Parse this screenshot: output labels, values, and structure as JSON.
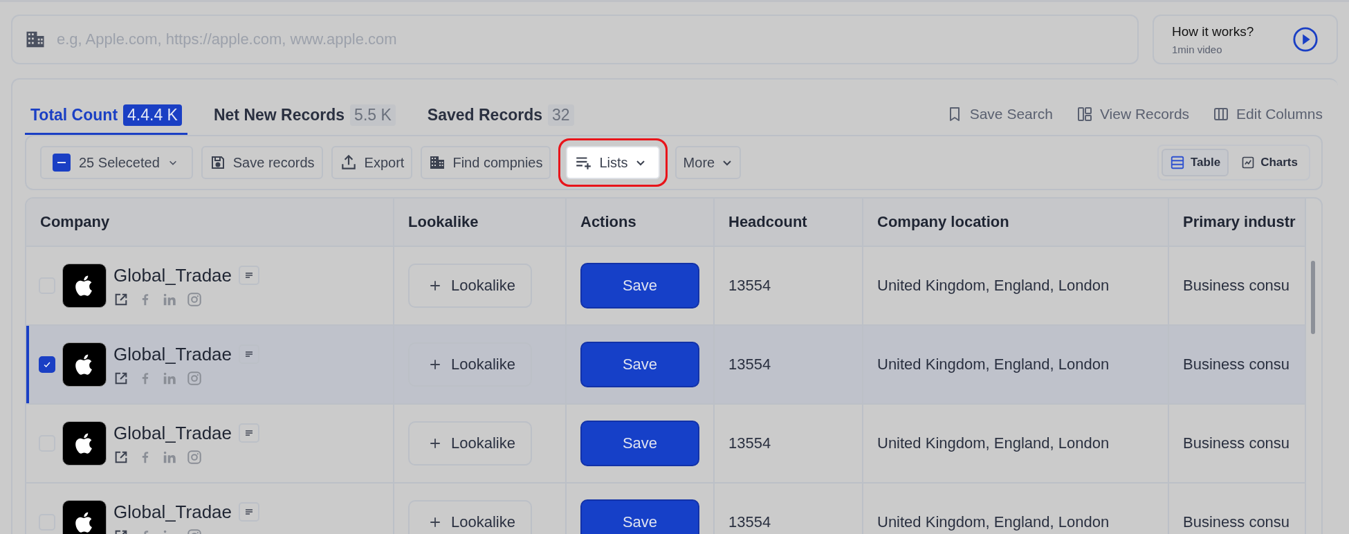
{
  "search": {
    "placeholder": "e.g, Apple.com, https://apple.com, www.apple.com"
  },
  "help_card": {
    "title": "How it works?",
    "subtitle": "1min video"
  },
  "tabs": [
    {
      "label": "Total Count",
      "count": "4.4.4 K",
      "selected": true
    },
    {
      "label": "Net New Records",
      "count": "5.5 K",
      "selected": false
    },
    {
      "label": "Saved Records",
      "count": "32",
      "selected": false
    }
  ],
  "header_actions": [
    "Save Search",
    "View Records",
    "Edit Columns"
  ],
  "toolbar": {
    "selection": {
      "label": "25 Seleceted"
    },
    "buttons": [
      {
        "label": "Save records",
        "highlighted": false
      },
      {
        "label": "Export",
        "highlighted": false
      },
      {
        "label": "Find compnies",
        "highlighted": false
      },
      {
        "label": "Lists",
        "highlighted": true
      },
      {
        "label": "More",
        "highlighted": false
      }
    ],
    "views": [
      {
        "label": "Table",
        "selected": true
      },
      {
        "label": "Charts",
        "selected": false
      }
    ]
  },
  "table": {
    "columns": [
      "Company",
      "Lookalike",
      "Actions",
      "Headcount",
      "Company location",
      "Primary industr"
    ],
    "rows": [
      {
        "selected": false,
        "name": "Global_Tradae",
        "lookalike": "Lookalike",
        "action": "Save",
        "headcount": "13554",
        "location": "United Kingdom, England, London",
        "industry": "Business consu"
      },
      {
        "selected": true,
        "name": "Global_Tradae",
        "lookalike": "Lookalike",
        "action": "Save",
        "headcount": "13554",
        "location": "United Kingdom, England, London",
        "industry": "Business consu"
      },
      {
        "selected": false,
        "name": "Global_Tradae",
        "lookalike": "Lookalike",
        "action": "Save",
        "headcount": "13554",
        "location": "United Kingdom, England, London",
        "industry": "Business consu"
      },
      {
        "selected": false,
        "name": "Global_Tradae",
        "lookalike": "Lookalike",
        "action": "Save",
        "headcount": "13554",
        "location": "United Kingdom, England, London",
        "industry": "Business consu"
      }
    ]
  }
}
